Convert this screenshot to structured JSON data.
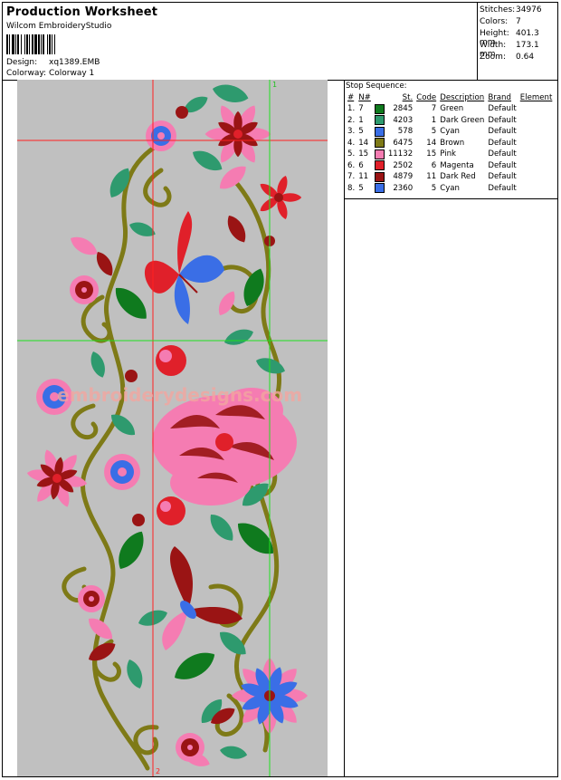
{
  "header": {
    "title": "Production Worksheet",
    "software": "Wilcom EmbroideryStudio",
    "design_label": "Design:",
    "design_value": "xq1389.EMB",
    "colorway_label": "Colorway:",
    "colorway_value": "Colorway 1"
  },
  "stats": [
    {
      "label": "Stitches:",
      "value": "34976"
    },
    {
      "label": "Colors:",
      "value": "7"
    },
    {
      "label": "Height:",
      "value": "401.3 mm"
    },
    {
      "label": "Width:",
      "value": "173.1 mm"
    },
    {
      "label": "Zoom:",
      "value": "0.64"
    }
  ],
  "preview": {
    "watermark": "embroiderydesigns.com",
    "marker_top": "1",
    "marker_bottom": "2"
  },
  "stop_sequence": {
    "title": "Stop Sequence:",
    "columns": [
      "#",
      "N#",
      "St.",
      "Code",
      "Description",
      "Brand",
      "Element"
    ],
    "rows": [
      {
        "idx": "1.",
        "n": "7",
        "st": "2845",
        "code": "7",
        "desc": "Green",
        "brand": "Default",
        "color": "#0f7a1e"
      },
      {
        "idx": "2.",
        "n": "1",
        "st": "4203",
        "code": "1",
        "desc": "Dark Green",
        "brand": "Default",
        "color": "#2e9a6e"
      },
      {
        "idx": "3.",
        "n": "5",
        "st": "578",
        "code": "5",
        "desc": "Cyan",
        "brand": "Default",
        "color": "#3a6ee6"
      },
      {
        "idx": "4.",
        "n": "14",
        "st": "6475",
        "code": "14",
        "desc": "Brown",
        "brand": "Default",
        "color": "#7e7a17"
      },
      {
        "idx": "5.",
        "n": "15",
        "st": "11132",
        "code": "15",
        "desc": "Pink",
        "brand": "Default",
        "color": "#f57cb2"
      },
      {
        "idx": "6.",
        "n": "6",
        "st": "2502",
        "code": "6",
        "desc": "Magenta",
        "brand": "Default",
        "color": "#e0202a"
      },
      {
        "idx": "7.",
        "n": "11",
        "st": "4879",
        "code": "11",
        "desc": "Dark Red",
        "brand": "Default",
        "color": "#9a1414"
      },
      {
        "idx": "8.",
        "n": "5",
        "st": "2360",
        "code": "5",
        "desc": "Cyan",
        "brand": "Default",
        "color": "#3a6ee6"
      }
    ]
  }
}
